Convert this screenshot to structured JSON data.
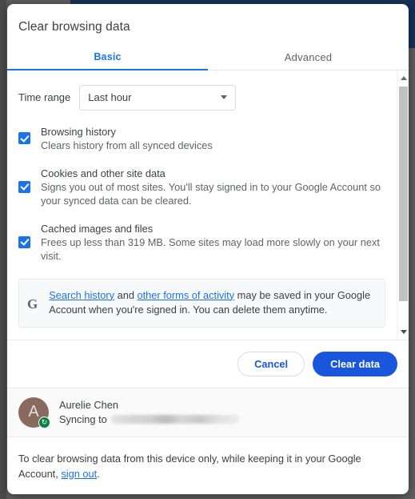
{
  "dialog": {
    "title": "Clear browsing data",
    "tabs": [
      {
        "label": "Basic",
        "active": true
      },
      {
        "label": "Advanced",
        "active": false
      }
    ],
    "time_range": {
      "label": "Time range",
      "value": "Last hour"
    },
    "options": [
      {
        "title": "Browsing history",
        "description": "Clears history from all synced devices",
        "checked": true
      },
      {
        "title": "Cookies and other site data",
        "description": "Signs you out of most sites. You'll stay signed in to your Google Account so your synced data can be cleared.",
        "checked": true
      },
      {
        "title": "Cached images and files",
        "description": "Frees up less than 319 MB. Some sites may load more slowly on your next visit.",
        "checked": true
      }
    ],
    "info_card": {
      "icon": "google-g-icon",
      "link1": "Search history",
      "mid": " and ",
      "link2": "other forms of activity",
      "rest": " may be saved in your Google Account when you're signed in. You can delete them anytime."
    },
    "buttons": {
      "cancel": "Cancel",
      "confirm": "Clear data"
    },
    "account": {
      "avatar_letter": "A",
      "name": "Aurelie Chen",
      "sync_prefix": "Syncing to",
      "sync_value_redacted": true,
      "badge": "sync-icon"
    },
    "footer": {
      "text_before": "To clear browsing data from this device only, while keeping it in your Google Account, ",
      "link": "sign out",
      "text_after": "."
    },
    "scrollbar": {
      "up": "scroll-up-arrow",
      "down": "scroll-down-arrow"
    }
  },
  "colors": {
    "accent": "#1a73e8",
    "primary_button": "#1a56db",
    "checkbox": "#1a73e8",
    "avatar": "#8a6a5f",
    "sync_badge": "#0b8043"
  }
}
